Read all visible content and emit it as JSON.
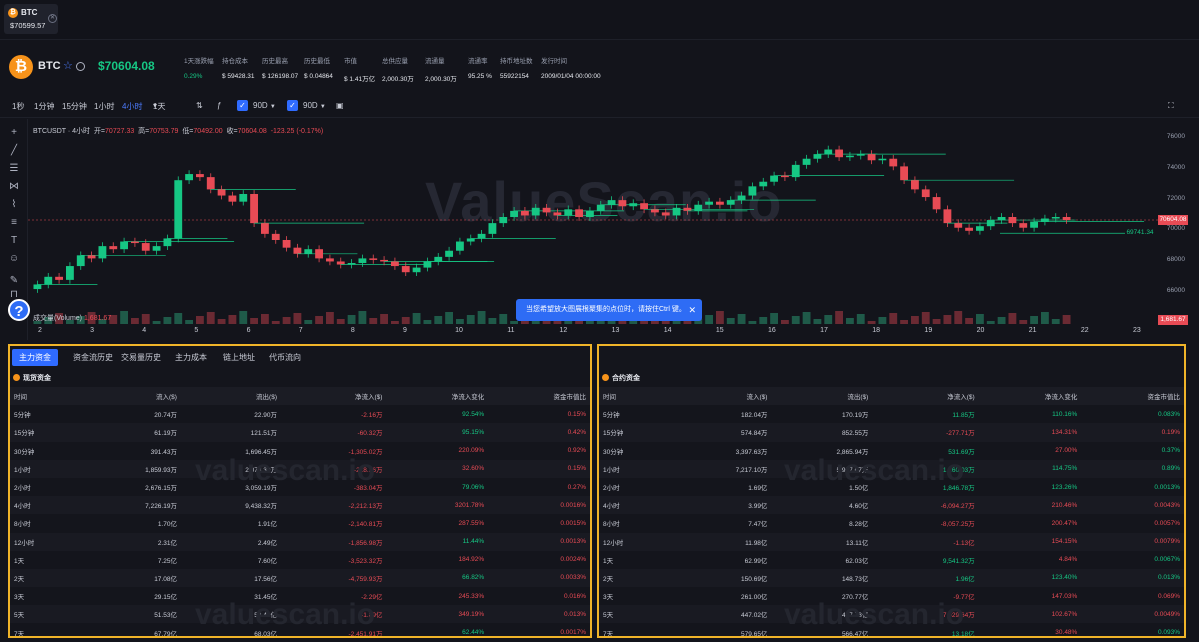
{
  "tab": {
    "symbol": "BTC",
    "price": "$70599.57"
  },
  "header": {
    "coin_symbol": "BTC",
    "price": "$70604.08",
    "stats": [
      {
        "label": "1天涨跌幅",
        "value": "0.29%",
        "tone": "g"
      },
      {
        "label": "持仓成本",
        "value": "$ 59428.31",
        "tone": ""
      },
      {
        "label": "历史最高",
        "value": "$ 126198.07",
        "tone": ""
      },
      {
        "label": "历史最低",
        "value": "$ 0.04864",
        "tone": ""
      },
      {
        "label": "市值",
        "value": "$ 1.41万亿",
        "tone": ""
      },
      {
        "label": "总供应量",
        "value": "2,000.30万",
        "tone": ""
      },
      {
        "label": "流通量",
        "value": "2,000.30万",
        "tone": ""
      },
      {
        "label": "流通率",
        "value": "95.25 %",
        "tone": ""
      },
      {
        "label": "持币地址数",
        "value": "55922154",
        "tone": ""
      },
      {
        "label": "发行时间",
        "value": "2009/01/04 00:00:00",
        "tone": ""
      }
    ]
  },
  "toolbar": {
    "intervals": [
      "1秒",
      "1分钟",
      "15分钟",
      "1小时",
      "4小时",
      "1天"
    ],
    "active_interval": "4小时",
    "option1": "90D",
    "option2": "90D"
  },
  "chart": {
    "title": "BTCUSDT · 4小时",
    "open_label": "开=",
    "open": "70727.33",
    "high_label": "高=",
    "high": "70753.79",
    "low_label": "低=",
    "low": "70492.00",
    "close_label": "收=",
    "close": "70604.08",
    "change": "-123.25 (-0.17%)",
    "volume_label": "成交量(Volume)",
    "volume_value": "1,681.67",
    "watermark": "ValueScan.io",
    "toast": "当您希望放大图展根聚集的点位时，请按住Ctrl 键。",
    "last_price_tag": "70604.08",
    "level_tag": "69741.34",
    "volume_tag": "1,681.67",
    "y_ticks": [
      "76000",
      "74000",
      "72000",
      "70000",
      "68000",
      "66000"
    ],
    "x_ticks": [
      "2",
      "3",
      "4",
      "5",
      "6",
      "7",
      "8",
      "9",
      "10",
      "11",
      "12",
      "13",
      "14",
      "15",
      "16",
      "17",
      "18",
      "19",
      "20",
      "21",
      "22",
      "23"
    ],
    "colors": {
      "up": "#16c784",
      "down": "#e84b55"
    }
  },
  "chart_data": {
    "type": "candlestick",
    "title": "BTCUSDT · 4小时",
    "ylim": [
      64800,
      76800
    ],
    "x_ticks": [
      "2",
      "3",
      "4",
      "5",
      "6",
      "7",
      "8",
      "9",
      "10",
      "11",
      "12",
      "13",
      "14",
      "15",
      "16",
      "17",
      "18",
      "19",
      "20",
      "21",
      "22",
      "23"
    ],
    "close_series": [
      66400,
      66900,
      66700,
      67600,
      68300,
      68100,
      68900,
      68700,
      69200,
      69100,
      68600,
      68900,
      69400,
      73200,
      73600,
      73400,
      72600,
      72200,
      71800,
      72300,
      70400,
      69700,
      69300,
      68800,
      68400,
      68700,
      68100,
      67900,
      67700,
      67800,
      68100,
      68000,
      67900,
      67600,
      67200,
      67500,
      67900,
      68200,
      68600,
      69200,
      69400,
      69700,
      70400,
      70800,
      71200,
      70900,
      71400,
      71100,
      70900,
      71300,
      70800,
      71200,
      71600,
      71900,
      71500,
      71700,
      71300,
      71100,
      70900,
      71400,
      71200,
      71600,
      71800,
      71600,
      71900,
      72200,
      72800,
      73100,
      73500,
      73400,
      74200,
      74600,
      74900,
      75200,
      74700,
      74800,
      74900,
      74500,
      74600,
      74100,
      73200,
      72600,
      72100,
      71300,
      70400,
      70100,
      69900,
      70200,
      70600,
      70800,
      70400,
      70100,
      70500,
      70700,
      70800,
      70600
    ]
  },
  "left_panel": {
    "tabs": [
      "主力资金",
      "资金流历史",
      "交易量历史",
      "主力成本",
      "链上地址",
      "代币流向"
    ],
    "active_tab": "主力资金",
    "section": "现货资金",
    "columns": [
      "时间",
      "流入($)",
      "流出($)",
      "净流入($)",
      "净流入变化",
      "资金市值比"
    ],
    "rows": [
      [
        "5分钟",
        "20.74万",
        "22.90万",
        "-2.16万",
        "92.54%",
        "0.15%"
      ],
      [
        "15分钟",
        "61.19万",
        "121.51万",
        "-60.32万",
        "95.15%",
        "0.42%"
      ],
      [
        "30分钟",
        "391.43万",
        "1,696.45万",
        "-1,305.02万",
        "220.09%",
        "0.92%"
      ],
      [
        "1小时",
        "1,859.93万",
        "2,078.30万",
        "-218.36万",
        "32.60%",
        "0.15%"
      ],
      [
        "2小时",
        "2,676.15万",
        "3,059.19万",
        "-383.04万",
        "79.06%",
        "0.27%"
      ],
      [
        "4小时",
        "7,226.19万",
        "9,438.32万",
        "-2,212.13万",
        "3201.78%",
        "0.0016%"
      ],
      [
        "8小时",
        "1.70亿",
        "1.91亿",
        "-2,140.81万",
        "287.55%",
        "0.0015%"
      ],
      [
        "12小时",
        "2.31亿",
        "2.49亿",
        "-1,856.98万",
        "11.44%",
        "0.0013%"
      ],
      [
        "1天",
        "7.25亿",
        "7.60亿",
        "-3,523.32万",
        "184.92%",
        "0.0024%"
      ],
      [
        "2天",
        "17.08亿",
        "17.56亿",
        "-4,759.93万",
        "66.82%",
        "0.0033%"
      ],
      [
        "3天",
        "29.15亿",
        "31.45亿",
        "-2.29亿",
        "245.33%",
        "0.016%"
      ],
      [
        "5天",
        "51.53亿",
        "53.42亿",
        "-1.89亿",
        "349.19%",
        "0.013%"
      ],
      [
        "7天",
        "67.79亿",
        "68.03亿",
        "-2,451.91万",
        "62.44%",
        "0.0017%"
      ]
    ],
    "tones": [
      [
        "",
        "",
        "",
        "neg",
        "pos",
        "neg"
      ],
      [
        "",
        "",
        "",
        "neg",
        "pos",
        "neg"
      ],
      [
        "",
        "",
        "",
        "neg",
        "neg",
        "neg"
      ],
      [
        "",
        "",
        "",
        "neg",
        "neg",
        "neg"
      ],
      [
        "",
        "",
        "",
        "neg",
        "pos",
        "neg"
      ],
      [
        "",
        "",
        "",
        "neg",
        "neg",
        "neg"
      ],
      [
        "",
        "",
        "",
        "neg",
        "neg",
        "neg"
      ],
      [
        "",
        "",
        "",
        "neg",
        "pos",
        "neg"
      ],
      [
        "",
        "",
        "",
        "neg",
        "neg",
        "neg"
      ],
      [
        "",
        "",
        "",
        "neg",
        "pos",
        "neg"
      ],
      [
        "",
        "",
        "",
        "neg",
        "neg",
        "neg"
      ],
      [
        "",
        "",
        "",
        "neg",
        "neg",
        "neg"
      ],
      [
        "",
        "",
        "",
        "neg",
        "pos",
        "neg"
      ]
    ]
  },
  "right_panel": {
    "section": "合约资金",
    "columns": [
      "时间",
      "流入($)",
      "流出($)",
      "净流入($)",
      "净流入变化",
      "资金市值比"
    ],
    "rows": [
      [
        "5分钟",
        "182.04万",
        "170.19万",
        "11.85万",
        "110.16%",
        "0.083%"
      ],
      [
        "15分钟",
        "574.84万",
        "852.55万",
        "-277.71万",
        "134.31%",
        "0.19%"
      ],
      [
        "30分钟",
        "3,397.63万",
        "2,865.94万",
        "531.69万",
        "27.00%",
        "0.37%"
      ],
      [
        "1小时",
        "7,217.10万",
        "5,957.07万",
        "1,260.03万",
        "114.75%",
        "0.89%"
      ],
      [
        "2小时",
        "1.69亿",
        "1.50亿",
        "1,846.78万",
        "123.26%",
        "0.0013%"
      ],
      [
        "4小时",
        "3.99亿",
        "4.60亿",
        "-6,094.27万",
        "210.46%",
        "0.0043%"
      ],
      [
        "8小时",
        "7.47亿",
        "8.28亿",
        "-8,057.25万",
        "200.47%",
        "0.0057%"
      ],
      [
        "12小时",
        "11.98亿",
        "13.11亿",
        "-1.13亿",
        "154.15%",
        "0.0079%"
      ],
      [
        "1天",
        "62.99亿",
        "62.03亿",
        "9,541.32万",
        "4.84%",
        "0.0067%"
      ],
      [
        "2天",
        "150.69亿",
        "148.73亿",
        "1.96亿",
        "123.40%",
        "0.013%"
      ],
      [
        "3天",
        "261.00亿",
        "270.77亿",
        "-9.77亿",
        "147.03%",
        "0.069%"
      ],
      [
        "5天",
        "447.02亿",
        "447.73亿",
        "-7,029.64万",
        "102.67%",
        "0.0049%"
      ],
      [
        "7天",
        "579.65亿",
        "566.47亿",
        "13.18亿",
        "30.48%",
        "0.093%"
      ]
    ],
    "tones": [
      [
        "",
        "",
        "",
        "pos",
        "pos",
        "pos"
      ],
      [
        "",
        "",
        "",
        "neg",
        "neg",
        "neg"
      ],
      [
        "",
        "",
        "",
        "pos",
        "neg",
        "pos"
      ],
      [
        "",
        "",
        "",
        "pos",
        "pos",
        "pos"
      ],
      [
        "",
        "",
        "",
        "pos",
        "pos",
        "pos"
      ],
      [
        "",
        "",
        "",
        "neg",
        "neg",
        "neg"
      ],
      [
        "",
        "",
        "",
        "neg",
        "neg",
        "neg"
      ],
      [
        "",
        "",
        "",
        "neg",
        "neg",
        "neg"
      ],
      [
        "",
        "",
        "",
        "pos",
        "neg",
        "pos"
      ],
      [
        "",
        "",
        "",
        "pos",
        "pos",
        "pos"
      ],
      [
        "",
        "",
        "",
        "neg",
        "neg",
        "neg"
      ],
      [
        "",
        "",
        "",
        "neg",
        "neg",
        "neg"
      ],
      [
        "",
        "",
        "",
        "pos",
        "neg",
        "pos"
      ]
    ]
  },
  "watermark_text": "valuescan.io"
}
